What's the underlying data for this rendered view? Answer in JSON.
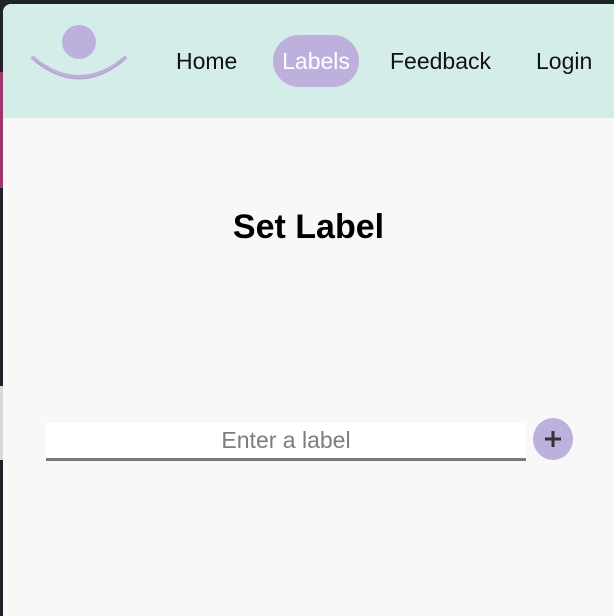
{
  "nav": {
    "home": "Home",
    "labels": "Labels",
    "feedback": "Feedback",
    "login": "Login",
    "active_item": "Labels"
  },
  "logo": {
    "icon": "smile-logo-icon",
    "color": "#bdb0dd"
  },
  "main": {
    "title": "Set Label",
    "label_input": {
      "value": "",
      "placeholder": "Enter a label"
    },
    "add_button": {
      "icon": "plus-icon"
    }
  },
  "colors": {
    "navbar_bg": "#d5ede9",
    "accent": "#bdb0dd",
    "page_bg": "#f8f8f8"
  }
}
